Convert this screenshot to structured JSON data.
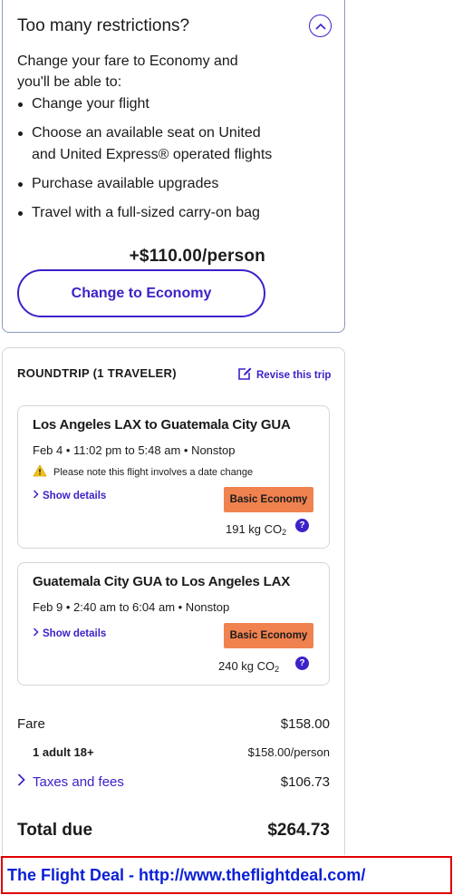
{
  "upsell": {
    "title": "Too many restrictions?",
    "intro": "Change your fare to Economy and you'll be able to:",
    "benefits": [
      "Change your flight",
      "Choose an available seat on United and United Express® operated flights",
      "Purchase available upgrades",
      "Travel with a full-sized carry-on bag"
    ],
    "price": "+$110.00/person",
    "button": "Change to Economy"
  },
  "summary": {
    "trip_type": "ROUNDTRIP (1 TRAVELER)",
    "revise": "Revise this trip",
    "segments": [
      {
        "route": "Los Angeles LAX to Guatemala City GUA",
        "time": "Feb 4 • 11:02 pm to 5:48 am • Nonstop",
        "warning": "Please note this flight involves a date change",
        "show_details": "Show details",
        "fare_class": "Basic Economy",
        "co2": "191 kg CO"
      },
      {
        "route": "Guatemala City GUA to Los Angeles LAX",
        "time": "Feb 9 • 2:40 am to 6:04 am • Nonstop",
        "show_details": "Show details",
        "fare_class": "Basic Economy",
        "co2": "240 kg CO"
      }
    ],
    "fare_label": "Fare",
    "fare_value": "$158.00",
    "adult_label": "1 adult 18+",
    "adult_value": "$158.00/person",
    "taxes_label": "Taxes and fees",
    "taxes_value": "$106.73",
    "total_label": "Total due",
    "total_value": "$264.73",
    "co2_subscript": "2",
    "help_glyph": "?"
  },
  "banner": {
    "text": "The Flight Deal - http://www.theflightdeal.com/"
  },
  "colors": {
    "accent": "#3b22c9",
    "fare_badge": "#f0824f",
    "banner_border": "#e00000",
    "banner_text": "#0b1fd6"
  },
  "icons": [
    "chevron-up-icon",
    "edit-icon",
    "warning-icon",
    "chevron-right-icon",
    "help-icon"
  ]
}
